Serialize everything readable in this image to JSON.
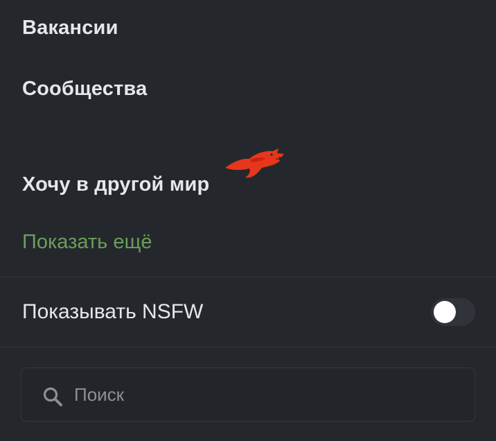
{
  "menu": {
    "items": [
      {
        "label": "Вакансии"
      },
      {
        "label": "Сообщества"
      },
      {
        "label": "Хочу в другой мир",
        "icon": "red-dragon-icon"
      }
    ],
    "show_more_label": "Показать ещё"
  },
  "settings": {
    "nsfw_label": "Показывать NSFW",
    "nsfw_enabled": false
  },
  "search": {
    "placeholder": "Поиск",
    "value": ""
  },
  "colors": {
    "background": "#24282d",
    "text": "#e6e7e8",
    "accent_green": "#6b9e5a",
    "dragon_red": "#e8361c"
  }
}
